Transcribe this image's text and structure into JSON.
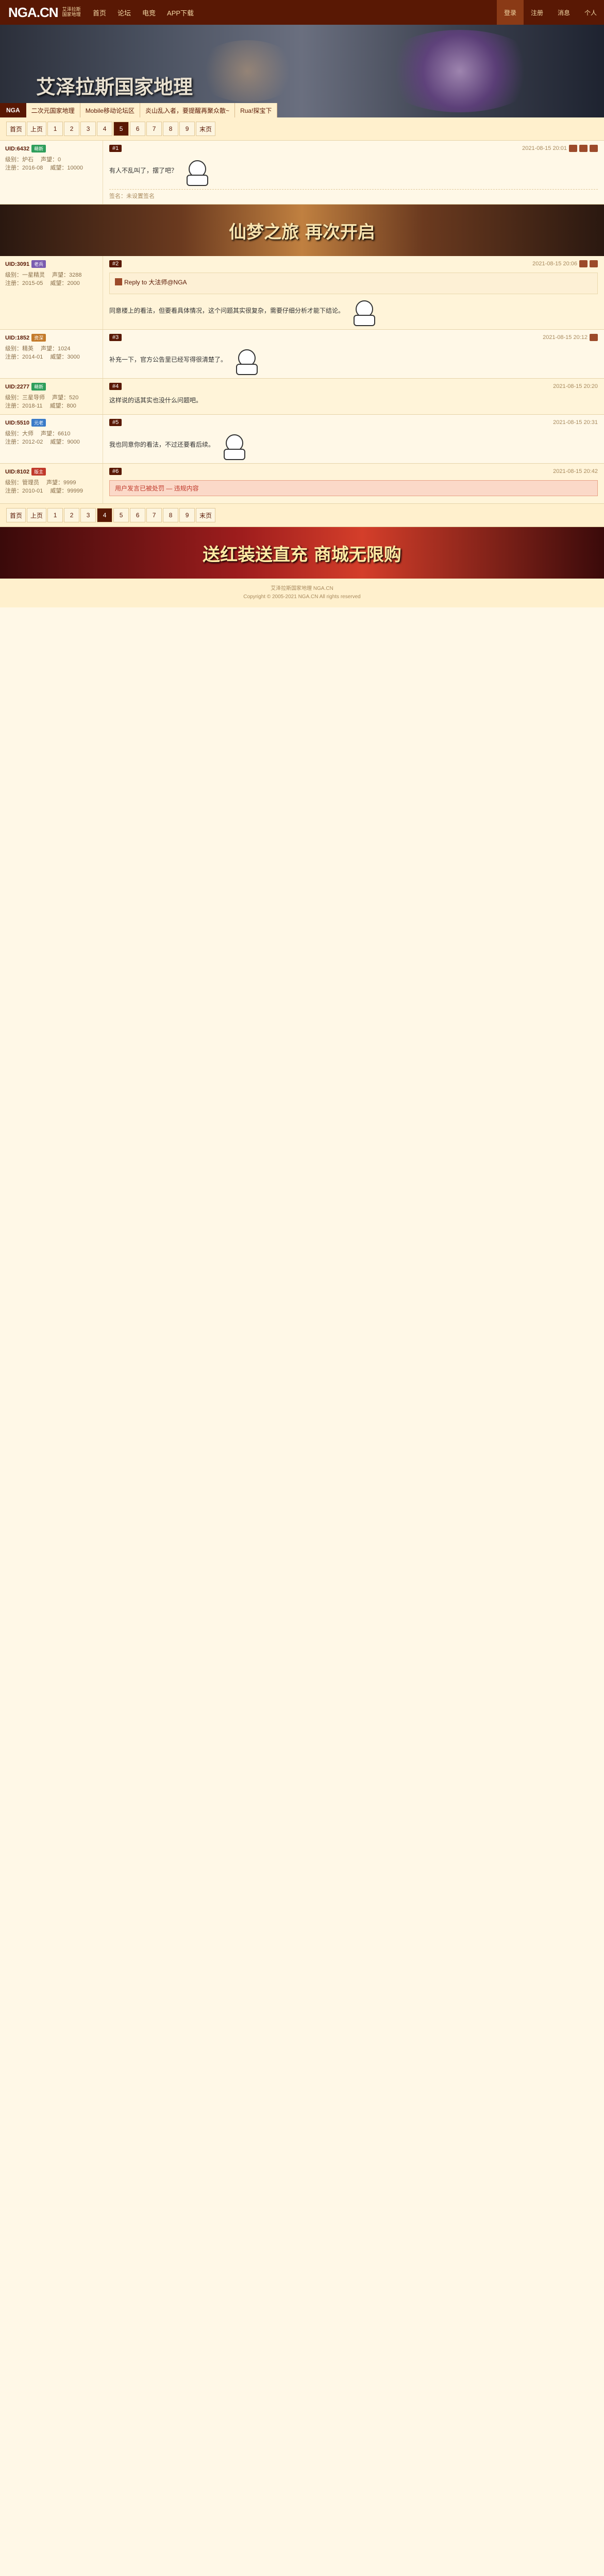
{
  "nav": {
    "logo": "NGA.CN",
    "logo_sub": "艾泽拉斯国家地理",
    "links": [
      "首页",
      "论坛",
      "电竞",
      "APP下载"
    ],
    "right": [
      "登录",
      "注册",
      "消息",
      "个人"
    ]
  },
  "banner": {
    "title": "艾泽拉斯国家地理"
  },
  "tagbar": {
    "logo": "NGA",
    "items": [
      "二次元国家地理",
      "Mobile移动论坛区",
      "炎山乱入者，要提醒再聚众散~",
      "Rua!探宝下"
    ]
  },
  "pager": {
    "items": [
      "首页",
      "上页",
      "1",
      "2",
      "3",
      "4",
      "5",
      "6",
      "7",
      "8",
      "9",
      "末页"
    ],
    "current_index": 6
  },
  "pager_bottom": {
    "items": [
      "首页",
      "上页",
      "1",
      "2",
      "3",
      "4",
      "5",
      "6",
      "7",
      "8",
      "9",
      "末页"
    ],
    "current_index": 5
  },
  "posts": [
    {
      "uid": "UID:6432",
      "badge": "萌新",
      "badge_color": "#2e9e5b",
      "floor": "#1",
      "time": "2021-08-15 20:01",
      "stats": [
        "级别：炉石",
        "声望：0",
        "注册：2016-08",
        "威望：10000"
      ],
      "content": "有人不乱叫了，摆了吧？",
      "sig": "签名：未设置签名"
    },
    {
      "uid": "UID:3091",
      "badge": "老兵",
      "badge_color": "#7a5cb0",
      "floor": "#2",
      "time": "2021-08-15 20:06",
      "stats": [
        "级别：一星精灵",
        "声望：3288",
        "注册：2015-05",
        "威望：2000"
      ],
      "quote_head": "Reply to 大法师@NGA",
      "content": "同意楼上的看法，但要看具体情况，这个问题其实很复杂，需要仔细分析才能下结论。"
    },
    {
      "uid": "UID:1852",
      "badge": "资深",
      "badge_color": "#c47b2b",
      "floor": "#3",
      "time": "2021-08-15 20:12",
      "stats": [
        "级别：精英",
        "声望：1024",
        "注册：2014-01",
        "威望：3000"
      ],
      "content": "补充一下，官方公告里已经写得很清楚了。"
    },
    {
      "uid": "UID:2277",
      "badge": "萌新",
      "badge_color": "#2e9e5b",
      "floor": "#4",
      "time": "2021-08-15 20:20",
      "stats": [
        "级别：三星导师",
        "声望：520",
        "注册：2018-11",
        "威望：800"
      ],
      "content": "这样说的话其实也没什么问题吧。"
    },
    {
      "uid": "UID:5510",
      "badge": "元老",
      "badge_color": "#3a7bc8",
      "floor": "#5",
      "time": "2021-08-15 20:31",
      "stats": [
        "级别：大师",
        "声望：6610",
        "注册：2012-02",
        "威望：9000"
      ],
      "content": "我也同意你的看法，不过还要看后续。"
    },
    {
      "uid": "UID:8102",
      "badge": "版主",
      "badge_color": "#c0392b",
      "floor": "#6",
      "time": "2021-08-15 20:42",
      "stats": [
        "级别：管理员",
        "声望：9999",
        "注册：2010-01",
        "威望：99999"
      ],
      "notice": "用户发言已被处罚 — 违规内容"
    }
  ],
  "ad": {
    "text": "仙梦之旅 再次开启"
  },
  "bottom_ad": {
    "text": "送红装送直充 商城无限购"
  },
  "footer": {
    "lines": [
      "艾泽拉斯国家地理 NGA.CN",
      "Copyright © 2005-2021 NGA.CN All rights reserved"
    ]
  }
}
